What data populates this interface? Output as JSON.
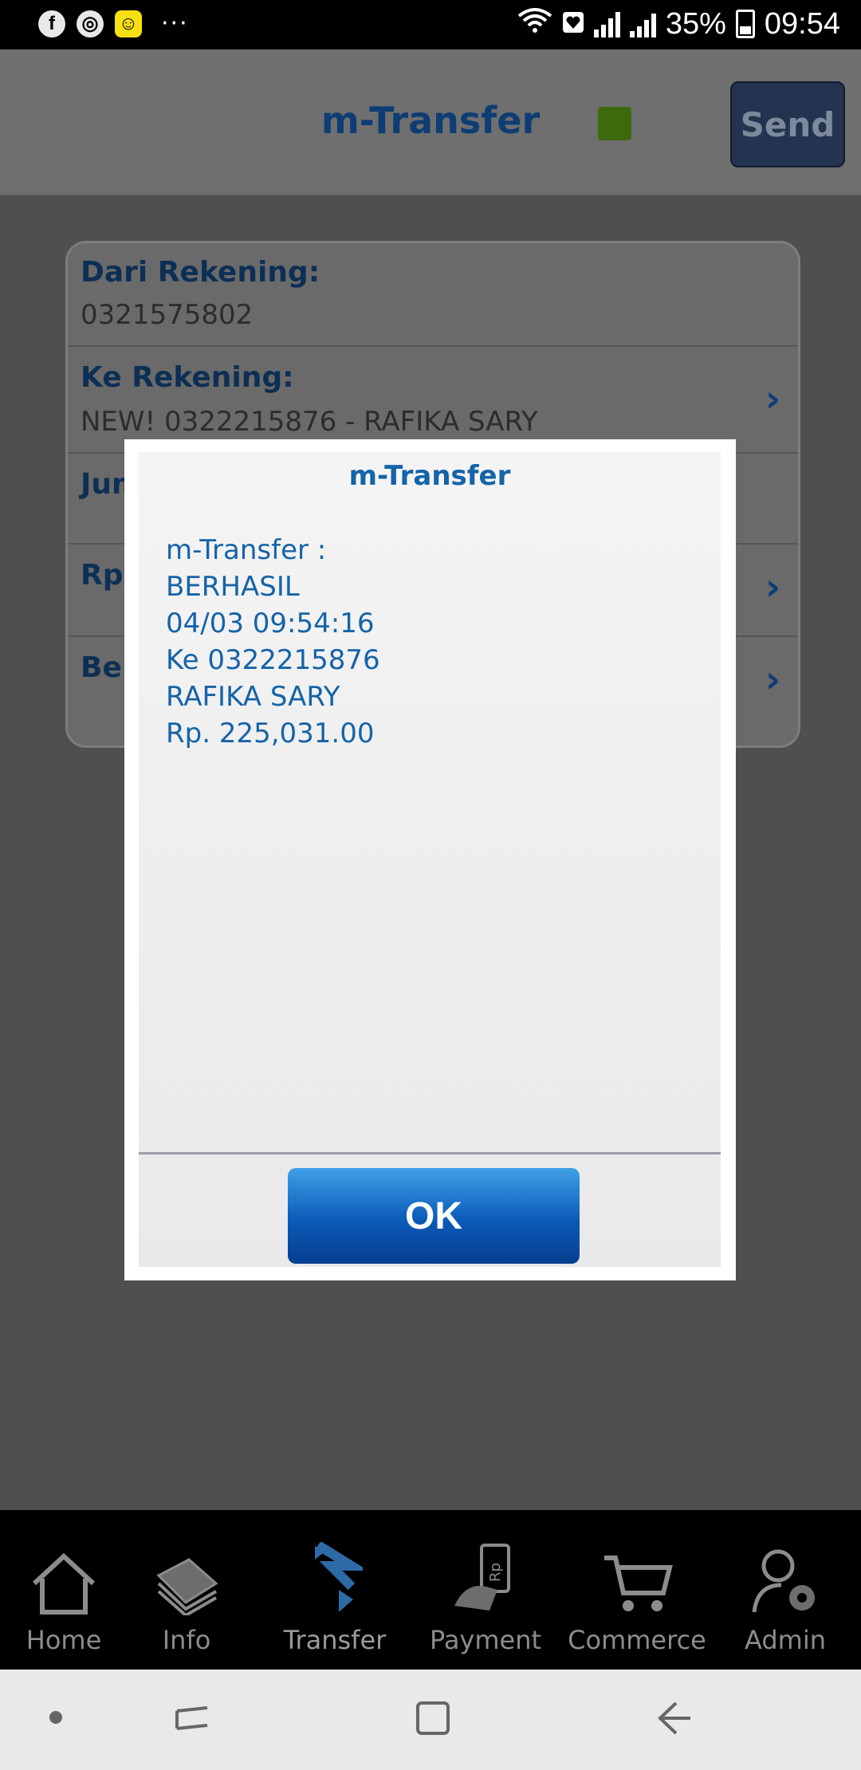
{
  "status_bar": {
    "left_icons": [
      "facebook-icon",
      "chrome-icon",
      "app-face-icon"
    ],
    "more": "···",
    "battery": "35%",
    "time": "09:54"
  },
  "header": {
    "title": "m-Transfer",
    "status_color": "#3d6a0d",
    "send_label": "Send"
  },
  "form": {
    "from_label": "Dari Rekening:",
    "from_value": "0321575802",
    "to_label": "Ke Rekening:",
    "to_value": "NEW! 0322215876 - RAFIKA SARY",
    "amount_label_partial": "Jum",
    "currency_partial": "Rp",
    "note_label_partial": "Ber"
  },
  "dialog": {
    "title": "m-Transfer",
    "lines": [
      "m-Transfer :",
      "BERHASIL",
      "04/03 09:54:16",
      "Ke 0322215876",
      "RAFIKA SARY",
      "Rp. 225,031.00"
    ],
    "ok_label": "OK"
  },
  "bottom_nav": {
    "items": [
      {
        "label": "Home",
        "icon": "home-icon"
      },
      {
        "label": "Info",
        "icon": "book-icon"
      },
      {
        "label": "Transfer",
        "icon": "transfer-icon"
      },
      {
        "label": "Payment",
        "icon": "payment-icon"
      },
      {
        "label": "Commerce",
        "icon": "cart-icon"
      },
      {
        "label": "Admin",
        "icon": "admin-gear-icon"
      }
    ],
    "active": "Transfer"
  },
  "colors": {
    "accent": "#1563a8",
    "button_blue": "#0a5ab8",
    "header_title": "#0e3d73"
  }
}
